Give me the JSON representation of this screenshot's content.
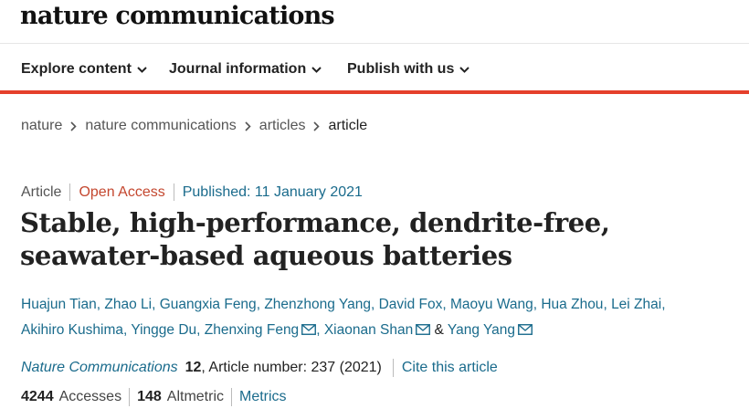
{
  "logo": "nature communications",
  "nav": {
    "explore": "Explore content",
    "journal": "Journal information",
    "publish": "Publish with us"
  },
  "breadcrumb": [
    "nature",
    "nature communications",
    "articles",
    "article"
  ],
  "meta": {
    "type": "Article",
    "access": "Open Access",
    "published": "Published: 11 January 2021"
  },
  "title": "Stable, high-performance, dendrite-free, seawater-based aqueous batteries",
  "authors": [
    "Huajun Tian",
    "Zhao Li",
    "Guangxia Feng",
    "Zhenzhong Yang",
    "David Fox",
    "Maoyu Wang",
    "Hua Zhou",
    "Lei Zhai",
    "Akihiro Kushima",
    "Yingge Du",
    "Zhenxing Feng",
    "Xiaonan Shan",
    "Yang Yang"
  ],
  "citation": {
    "journal": "Nature Communications",
    "volume": "12",
    "article_number": ", Article number: 237 (2021)",
    "cite_label": "Cite this article"
  },
  "metrics": {
    "accesses_count": "4244",
    "accesses_label": "Accesses",
    "altmetric_count": "148",
    "altmetric_label": "Altmetric",
    "metrics_label": "Metrics"
  },
  "colors": {
    "accent_red": "#e5402c",
    "link_blue": "#1a6b8c",
    "open_access": "#c4472f"
  }
}
